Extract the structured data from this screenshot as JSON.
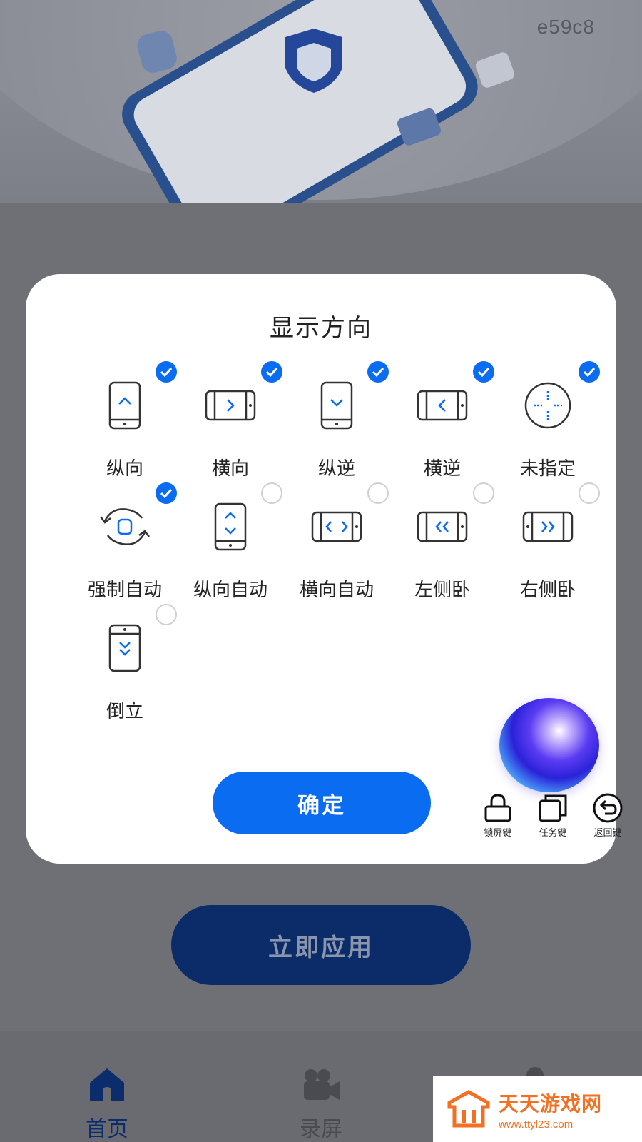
{
  "hero": {
    "code": "e59c8"
  },
  "background_button": {
    "label": "立即应用"
  },
  "pager": {
    "count": 4,
    "active_index": 1
  },
  "tabbar": {
    "tabs": [
      {
        "label": "首页",
        "icon": "home-icon",
        "active": true
      },
      {
        "label": "录屏",
        "icon": "video-camera-icon",
        "active": false
      },
      {
        "label": "",
        "icon": "profile-icon",
        "active": false
      }
    ]
  },
  "dialog": {
    "title": "显示方向",
    "options": [
      {
        "label": "纵向",
        "icon": "portrait-icon",
        "checked": true
      },
      {
        "label": "横向",
        "icon": "landscape-icon",
        "checked": true
      },
      {
        "label": "纵逆",
        "icon": "reverse-portrait-icon",
        "checked": true
      },
      {
        "label": "横逆",
        "icon": "reverse-landscape-icon",
        "checked": true
      },
      {
        "label": "未指定",
        "icon": "unspecified-icon",
        "checked": true
      },
      {
        "label": "强制自动",
        "icon": "force-auto-rotate-icon",
        "checked": true
      },
      {
        "label": "纵向自动",
        "icon": "portrait-auto-icon",
        "checked": false
      },
      {
        "label": "横向自动",
        "icon": "landscape-auto-icon",
        "checked": false
      },
      {
        "label": "左侧卧",
        "icon": "lie-left-icon",
        "checked": false
      },
      {
        "label": "右侧卧",
        "icon": "lie-right-icon",
        "checked": false
      },
      {
        "label": "倒立",
        "icon": "upside-down-icon",
        "checked": false
      }
    ],
    "confirm_label": "确定"
  },
  "floating_keys": [
    {
      "label": "锁屏键",
      "icon": "lock-icon"
    },
    {
      "label": "任务键",
      "icon": "task-icon"
    },
    {
      "label": "返回键",
      "icon": "back-icon"
    }
  ],
  "watermark": {
    "title": "天天游戏网",
    "url": "www.ttyl23.com"
  },
  "colors": {
    "accent": "#0a6cf0",
    "icon_stroke": "#333333",
    "overlay": "#6f7075"
  }
}
